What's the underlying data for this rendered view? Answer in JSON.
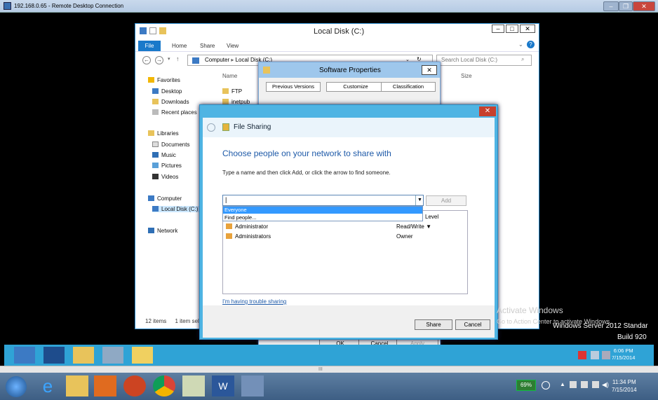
{
  "rdp": {
    "title": "192.168.0.65 - Remote Desktop Connection",
    "minimize": "–",
    "restore": "❐",
    "close": "✕"
  },
  "explorer": {
    "title": "Local Disk (C:)",
    "controls": {
      "minimize": "–",
      "maximize": "□",
      "close": "✕"
    },
    "ribbon": {
      "file": "File",
      "home": "Home",
      "share": "Share",
      "view": "View"
    },
    "address": {
      "computer": "Computer",
      "disk": "Local Disk (C:)",
      "search_placeholder": "Search Local Disk (C:)"
    },
    "nav": {
      "favorites": "Favorites",
      "desktop": "Desktop",
      "downloads": "Downloads",
      "recent": "Recent places",
      "libraries": "Libraries",
      "documents": "Documents",
      "music": "Music",
      "pictures": "Pictures",
      "videos": "Videos",
      "computer": "Computer",
      "local_disk": "Local Disk (C:)",
      "network": "Network"
    },
    "columns": {
      "name": "Name",
      "size": "Size"
    },
    "files": [
      "FTP",
      "inetpub"
    ],
    "status": {
      "items": "12 items",
      "selected": "1 item sel"
    }
  },
  "properties": {
    "title": "Software Properties",
    "close": "✕",
    "tabs": [
      "Previous Versions",
      "Customize",
      "Classification"
    ],
    "buttons": {
      "ok": "OK",
      "cancel": "Cancel",
      "apply": "Apply"
    }
  },
  "sharing": {
    "close": "✕",
    "title": "File Sharing",
    "heading": "Choose people on your network to share with",
    "instructions": "Type a name and then click Add, or click the arrow to find someone.",
    "input_value": "|",
    "add": "Add",
    "dropdown": {
      "everyone": "Everyone",
      "find": "Find people..."
    },
    "level_header": "Level",
    "people": [
      {
        "name": "Administrator",
        "level": "Read/Write ▼"
      },
      {
        "name": "Administrators",
        "level": "Owner"
      }
    ],
    "trouble_link": "I'm having trouble sharing",
    "share_btn": "Share",
    "cancel_btn": "Cancel"
  },
  "watermark": {
    "line1": "Activate Windows",
    "line2": "Go to Action Center to activate Windows.",
    "product": "Windows Server 2012 Standar",
    "build": "Build 920"
  },
  "remote_clock": {
    "time": "6:06 PM",
    "date": "7/15/2014"
  },
  "local_clock": {
    "time": "11:34 PM",
    "date": "7/15/2014"
  },
  "battery": "69%",
  "scroll_glyph": "III"
}
